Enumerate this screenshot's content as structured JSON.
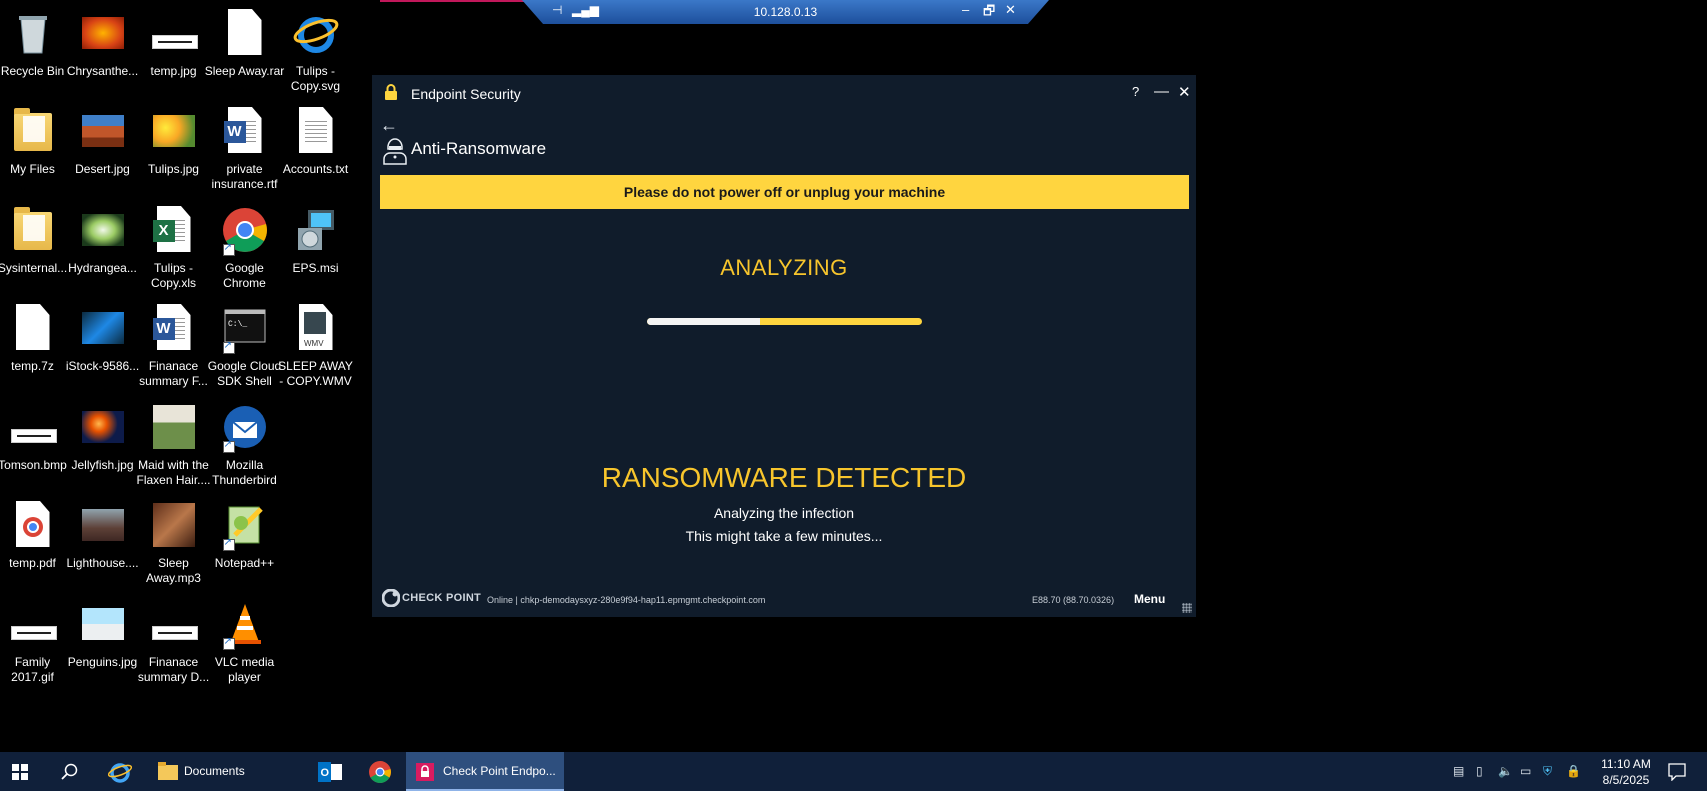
{
  "desktop": {
    "icons": [
      {
        "label": "Recycle Bin"
      },
      {
        "label": "Chrysanthe..."
      },
      {
        "label": "temp.jpg"
      },
      {
        "label": "Sleep Away.rar"
      },
      {
        "label": "Tulips - Copy.svg"
      },
      {
        "label": "My Files"
      },
      {
        "label": "Desert.jpg"
      },
      {
        "label": "Tulips.jpg"
      },
      {
        "label": "private insurance.rtf"
      },
      {
        "label": "Accounts.txt"
      },
      {
        "label": "Sysinternal..."
      },
      {
        "label": "Hydrangea..."
      },
      {
        "label": "Tulips - Copy.xls"
      },
      {
        "label": "Google Chrome"
      },
      {
        "label": "EPS.msi"
      },
      {
        "label": "temp.7z"
      },
      {
        "label": "iStock-9586..."
      },
      {
        "label": "Finanace summary F..."
      },
      {
        "label": "Google Cloud SDK Shell"
      },
      {
        "label": "SLEEP AWAY - COPY.WMV"
      },
      {
        "label": "Tomson.bmp"
      },
      {
        "label": "Jellyfish.jpg"
      },
      {
        "label": "Maid with the Flaxen Hair...."
      },
      {
        "label": "Mozilla Thunderbird"
      },
      {
        "label": "temp.pdf"
      },
      {
        "label": "Lighthouse...."
      },
      {
        "label": "Sleep Away.mp3"
      },
      {
        "label": "Notepad++"
      },
      {
        "label": "Family 2017.gif"
      },
      {
        "label": "Penguins.jpg"
      },
      {
        "label": "Finanace summary D..."
      },
      {
        "label": "VLC media player"
      }
    ]
  },
  "rdp": {
    "host": "10.128.0.13",
    "minimize": "‒",
    "restore": "🗗",
    "close": "✕"
  },
  "window": {
    "title": "Endpoint Security",
    "help": "?",
    "minimize": "—",
    "close": "✕",
    "back": "←",
    "section_title": "Anti-Ransomware",
    "banner": "Please do not power off or unplug your machine",
    "analyzing": "ANALYZING",
    "progress_fraction": 0.41,
    "detected": "RANSOMWARE DETECTED",
    "status_line1": "Analyzing the infection",
    "status_line2": "This might take a few minutes...",
    "brand": "CHECK POINT",
    "connection": "Online  |  chkp-demodaysxyz-280e9f94-hap11.epmgmt.checkpoint.com",
    "version": "E88.70  (88.70.0326)",
    "menu": "Menu"
  },
  "taskbar": {
    "documents": "Documents",
    "checkpoint": "Check Point Endpo...",
    "time": "11:10 AM",
    "date": "8/5/2025"
  },
  "colors": {
    "accent_yellow": "#ffd53f",
    "heading_yellow": "#f7c52c",
    "window_bg": "#101c2b",
    "taskbar_bg": "#10203a"
  }
}
